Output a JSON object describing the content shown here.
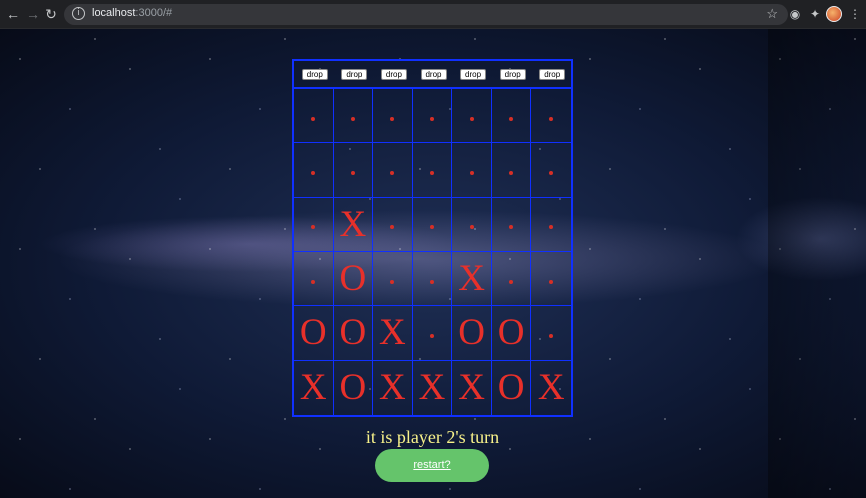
{
  "browser": {
    "url_host": "localhost",
    "url_rest": ":3000/#"
  },
  "game": {
    "drop_label": "drop",
    "columns": 7,
    "rows": [
      [
        "",
        "",
        "",
        "",
        "",
        "",
        ""
      ],
      [
        "",
        "",
        "",
        "",
        "",
        "",
        ""
      ],
      [
        "",
        "X",
        "",
        "",
        "",
        "",
        ""
      ],
      [
        "",
        "O",
        "",
        "",
        "X",
        "",
        ""
      ],
      [
        "O",
        "O",
        "X",
        "",
        "O",
        "O",
        ""
      ],
      [
        "X",
        "O",
        "X",
        "X",
        "X",
        "O",
        "X"
      ]
    ],
    "turn_text": "it is player 2's turn",
    "restart_label": "restart?",
    "colors": {
      "grid": "#1030ff",
      "piece": "#e8302a",
      "turn_text": "#f8f28a",
      "restart_button": "#65c46b"
    }
  }
}
